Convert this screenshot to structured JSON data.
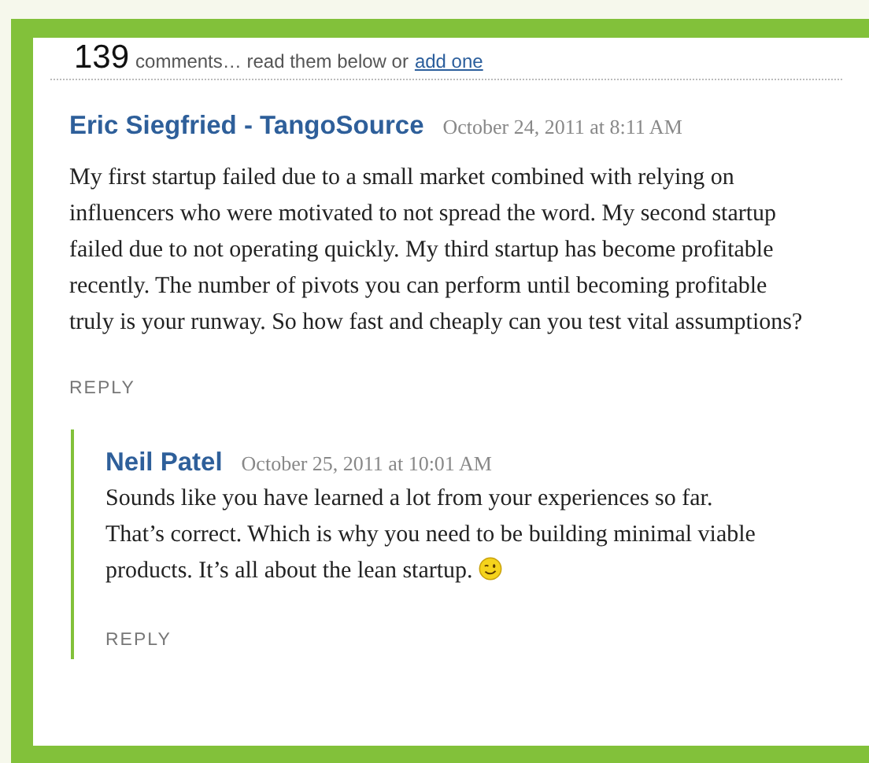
{
  "header": {
    "count": "139",
    "text": "comments… read them below or",
    "link": "add one"
  },
  "comments": [
    {
      "author": "Eric Siegfried - TangoSource",
      "date": "October 24, 2011 at 8:11 AM",
      "body": "My first startup failed due to a small market combined with relying on influencers who were motivated to not spread the word. My second startup failed due to not operating quickly. My third startup has become profitable recently. The number of pivots you can perform until becoming profitable truly is your runway. So how fast and cheaply can you test vital assumptions?",
      "reply": "REPLY",
      "children": [
        {
          "author": "Neil Patel",
          "date": "October 25, 2011 at 10:01 AM",
          "body": "Sounds like you have learned a lot from your experiences so far. That’s correct. Which is why you need to be building minimal viable products. It’s all about the lean startup.",
          "emoticon": true,
          "reply": "REPLY"
        }
      ]
    }
  ]
}
